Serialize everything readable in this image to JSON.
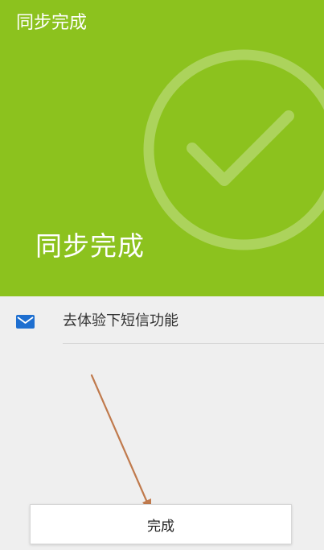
{
  "header": {
    "title": "同步完成"
  },
  "hero": {
    "heading": "同步完成",
    "icon": "check-circle-icon"
  },
  "list": {
    "items": [
      {
        "label": "去体验下短信功能",
        "icon": "mail-icon"
      }
    ]
  },
  "footer": {
    "done_label": "完成"
  },
  "colors": {
    "hero_green": "#8cc21e",
    "mail_blue": "#1e6fd0",
    "arrow": "#c07a4d"
  }
}
